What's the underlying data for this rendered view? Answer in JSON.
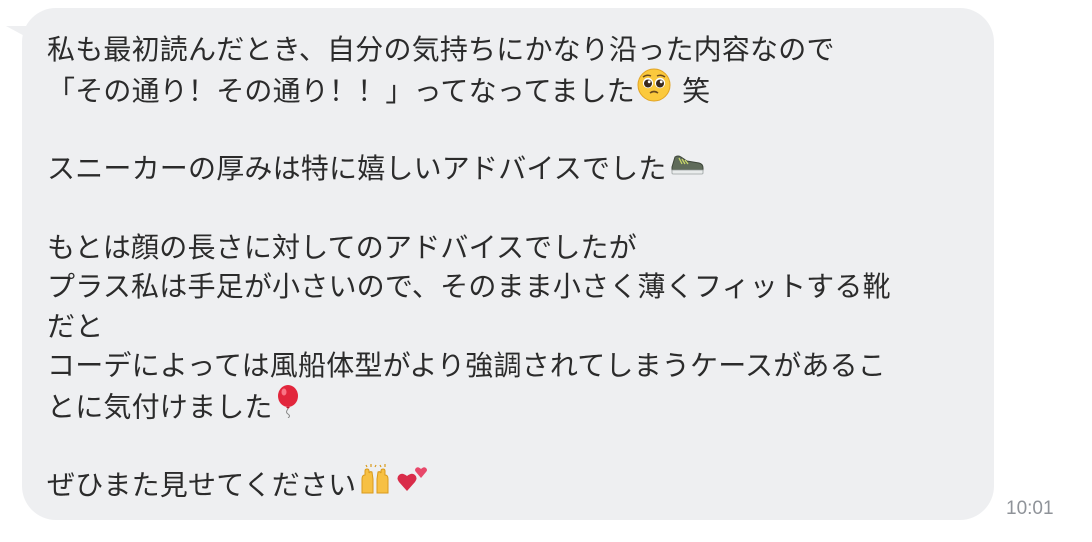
{
  "message": {
    "lines": [
      "私も最初読んだとき、自分の気持ちにかなり沿った内容なので",
      "「その通り！その通り！！」ってなってました",
      "笑",
      "",
      "スニーカーの厚みは特に嬉しいアドバイスでした",
      "",
      "もとは顔の長さに対してのアドバイスでしたが",
      "プラス私は手足が小さいので、そのまま小さく薄くフィットする靴",
      "だと",
      "コーデによっては風船体型がより強調されてしまうケースがあるこ",
      "とに気付けました",
      "",
      "ぜひまた見せてください"
    ],
    "emojis": {
      "pleading": "pleading-face-emoji",
      "sneaker": "sneaker-emoji",
      "balloon": "balloon-emoji",
      "raised_hands": "raised-hands-emoji",
      "two_hearts": "two-hearts-emoji"
    }
  },
  "timestamp": "10:01",
  "colors": {
    "bubble": "#eeeff1",
    "text": "#2b2b2b",
    "timestamp": "#8f9399"
  }
}
